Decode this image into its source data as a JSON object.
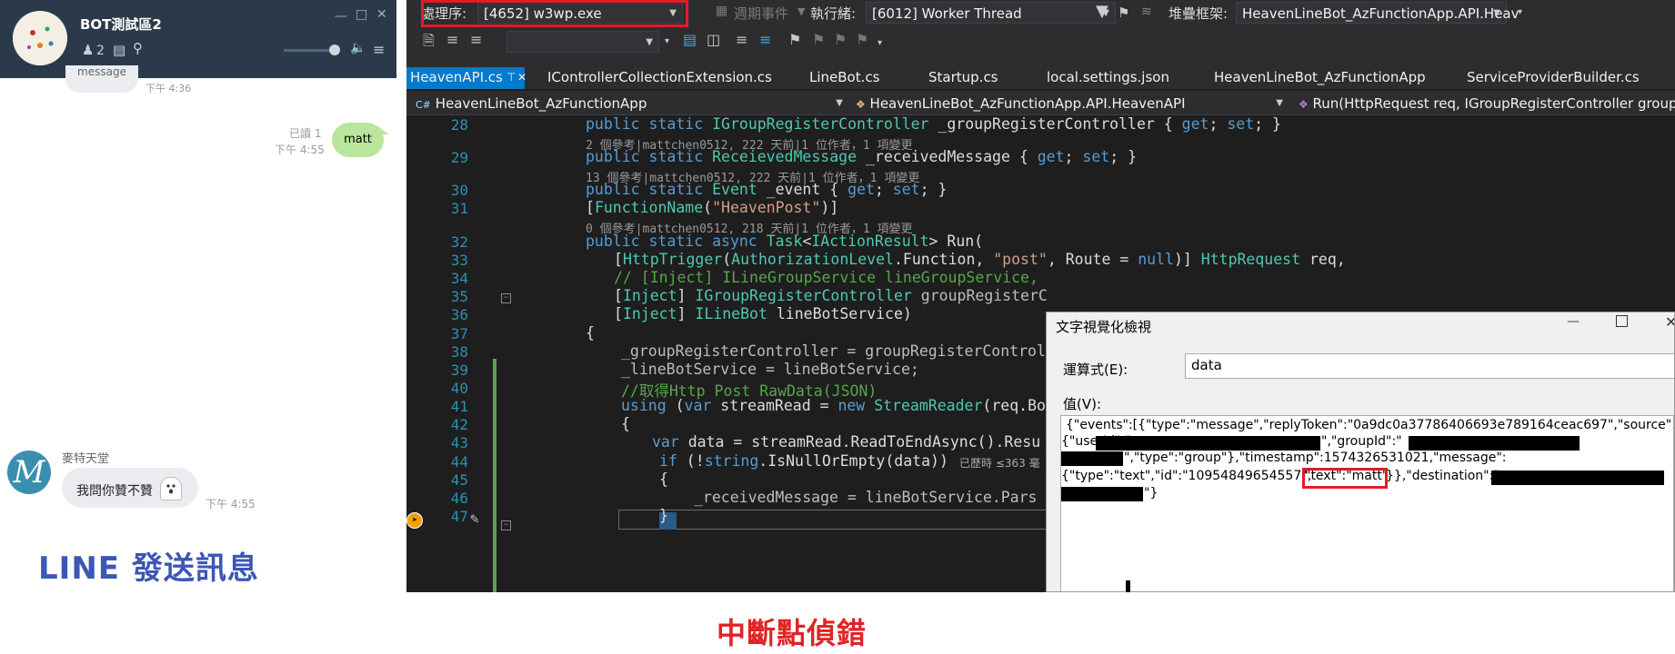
{
  "line": {
    "group_name": "BOT測試區2",
    "member_count": "2",
    "msg1": {
      "text": "message",
      "time": "下午 4:36"
    },
    "msg2": {
      "read": "已讀 1",
      "time": "下午 4:55",
      "text": "matt"
    },
    "msg3": {
      "sender": "麥特天堂",
      "avatar_letter": "M",
      "text": "我問你贊不贊",
      "time": "下午 4:55"
    },
    "caption": "LINE 發送訊息"
  },
  "vs": {
    "process_label": "處理序:",
    "process_value": "[4652] w3wp.exe",
    "lifecycle_label": "週期事件",
    "thread_label": "執行緒:",
    "thread_value": "[6012] Worker Thread",
    "stack_label": "堆疊框架:",
    "stack_value": "HeavenLineBot_AzFunctionApp.API.Heav",
    "tabs": [
      "HeavenAPI.cs",
      "IControllerCollectionExtension.cs",
      "LineBot.cs",
      "Startup.cs",
      "local.settings.json",
      "HeavenLineBot_AzFunctionApp",
      "ServiceProviderBuilder.cs"
    ],
    "nav_project": "HeavenLineBot_AzFunctionApp",
    "nav_class": "HeavenLineBot_AzFunctionApp.API.HeavenAPI",
    "nav_method": "Run(HttpRequest req, IGroupRegisterController groupRe",
    "line_numbers": [
      "28",
      "29",
      "30",
      "31",
      "32",
      "33",
      "34",
      "35",
      "36",
      "37",
      "38",
      "39",
      "40",
      "41",
      "42",
      "43",
      "44",
      "45",
      "46",
      "47"
    ],
    "lens_28": "2 個參考|mattchen0512, 222 天前|1 位作者，1 項變更",
    "lens_29": "13 個參考|mattchen0512, 222 天前|1 位作者，1 項變更",
    "lens_31": "0 個參考|mattchen0512, 218 天前|1 位作者，1 項變更",
    "code": {
      "l28": {
        "a": "public static ",
        "b": "IGroupRegisterController",
        "c": " _groupRegisterController { ",
        "d": "get",
        "e": "; ",
        "f": "set",
        "g": "; }"
      },
      "l29": {
        "a": "public static ",
        "b": "ReceievedMessage",
        "c": " _receivedMessage { ",
        "d": "get",
        "e": "; ",
        "f": "set",
        "g": "; }"
      },
      "l30": {
        "a": "public static ",
        "b": "Event",
        "c": " _event { ",
        "d": "get",
        "e": "; ",
        "f": "set",
        "g": "; }"
      },
      "l31": {
        "a": "[",
        "b": "FunctionName",
        "c": "(",
        "d": "\"HeavenPost\"",
        "e": ")]"
      },
      "l32": {
        "a": "public static async ",
        "b": "Task",
        "c": "<",
        "d": "IActionResult",
        "e": "> Run("
      },
      "l33": {
        "a": "[",
        "b": "HttpTrigger",
        "c": "(",
        "d": "AuthorizationLevel",
        "e": ".Function, ",
        "f": "\"post\"",
        "g": ", Route = ",
        "h": "null",
        "i": ")] ",
        "j": "HttpRequest",
        "k": " req,"
      },
      "l34": "// [Inject] ILineGroupService lineGroupService,",
      "l35": {
        "a": "[",
        "b": "Inject",
        "c": "] ",
        "d": "IGroupRegisterController",
        "e": " groupRegisterC"
      },
      "l36": {
        "a": "[",
        "b": "Inject",
        "c": "] ",
        "d": "ILineBot",
        "e": " lineBotService)"
      },
      "l37": "{",
      "l38": {
        "a": "_groupRegisterController = groupRegisterControl"
      },
      "l39": {
        "a": "_lineBotService = lineBotService;"
      },
      "l40": "//取得Http Post RawData(JSON)",
      "l41": {
        "a": "using",
        "b": " (",
        "c": "var",
        "d": " streamRead = ",
        "e": "new ",
        "f": "StreamReader",
        "g": "(req.Bo"
      },
      "l42": "{",
      "l43": {
        "a": "var",
        "b": " data = streamRead.ReadToEndAsync().Resu"
      },
      "l44": {
        "a": "if",
        "b": " (!",
        "c": "string",
        "d": ".IsNullOrEmpty(data))"
      },
      "l45": "{",
      "l46": {
        "a": "_receivedMessage = lineBotService.Pars"
      },
      "l47": "}"
    },
    "elapsed": "已歷時 ≤363 毫"
  },
  "visualizer": {
    "title": "文字視覺化檢視",
    "expr_label": "運算式(E):",
    "expr_value": "data",
    "value_label": "值(V):",
    "line1": "{\"events\":[{\"type\":\"message\",\"replyToken\":\"0a9dc0a37786406693e789164ceac697\",\"source\":",
    "line2a": "{\"userId\":\"",
    "line2b": "\",\"groupId\":\"",
    "line3": "\",\"type\":\"group\"},\"timestamp\":1574326531021,\"message\":",
    "line4a": "{\"type\":\"text\",\"id\":\"10954849654557\",",
    "line4b": "\"text\":\"matt\"",
    "line4c": "}},\"destination\":\"",
    "line5": "\"}"
  },
  "caption_debug": "中斷點偵錯",
  "colors": {
    "line_header": "#2b3a4a",
    "line_bubble_self": "#b9e69c",
    "vs_background": "#1e1e1e",
    "vs_accent": "#007acc",
    "highlight_red": "#e31b23",
    "caption_blue": "#3c57b6",
    "caption_red": "#e02424"
  }
}
